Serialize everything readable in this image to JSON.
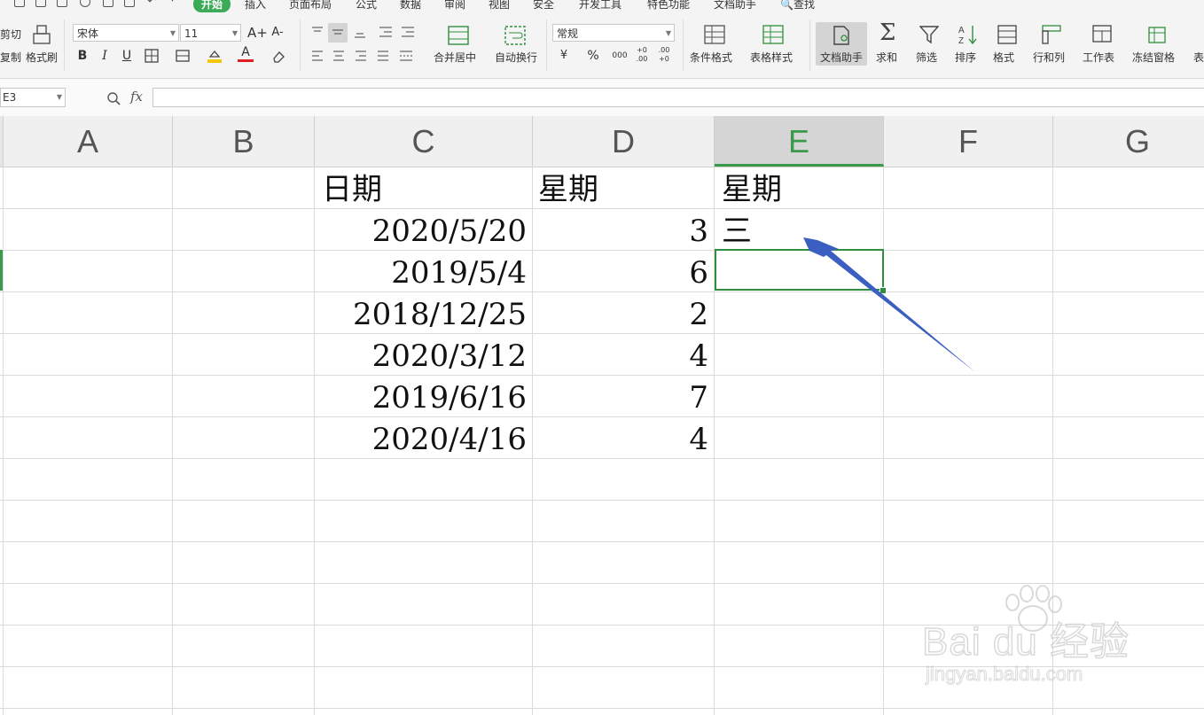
{
  "menu": {
    "tabs": [
      "开始",
      "插入",
      "页面布局",
      "公式",
      "数据",
      "审阅",
      "视图",
      "安全",
      "开发工具",
      "特色功能",
      "文档助手"
    ],
    "search_label": "查找"
  },
  "ribbon": {
    "cut": "剪切",
    "copy": "复制",
    "format_painter": "格式刷",
    "font_name": "宋体",
    "font_size": "11",
    "number_format": "常规",
    "merge_center": "合并居中",
    "wrap_text": "自动换行",
    "conditional_format": "条件格式",
    "table_style": "表格样式",
    "doc_assistant": "文档助手",
    "sum": "求和",
    "filter": "筛选",
    "sort": "排序",
    "format": "格式",
    "row_col": "行和列",
    "worksheet": "工作表",
    "freeze": "冻结窗格",
    "more": "表",
    "bold": "B",
    "italic": "I",
    "underline": "U",
    "percent": "%",
    "currency": "¥",
    "thousands": "000",
    "dec_inc": "+0 .00",
    "dec_dec": ".00 +0",
    "grow_font": "A+",
    "shrink_font": "A-",
    "font_color": "A"
  },
  "formula_bar": {
    "name_box": "E3",
    "fx": "fx",
    "value": ""
  },
  "columns": [
    "A",
    "B",
    "C",
    "D",
    "E",
    "F",
    "G"
  ],
  "selected_column": "E",
  "cells": {
    "C1": "日期",
    "D1": "星期",
    "E1": "星期",
    "C2": "2020/5/20",
    "D2": "3",
    "E2": "三",
    "C3": "2019/5/4",
    "D3": "6",
    "C4": "2018/12/25",
    "D4": "2",
    "C5": "2020/3/12",
    "D5": "4",
    "C6": "2019/6/16",
    "D6": "7",
    "C7": "2020/4/16",
    "D7": "4"
  },
  "colors": {
    "accent": "#3cab58",
    "selection": "#2f8f3f",
    "arrow": "#3b5fc0"
  },
  "watermark": {
    "line1": "Bai du 经验",
    "line2": "jingyan.baidu.com"
  }
}
